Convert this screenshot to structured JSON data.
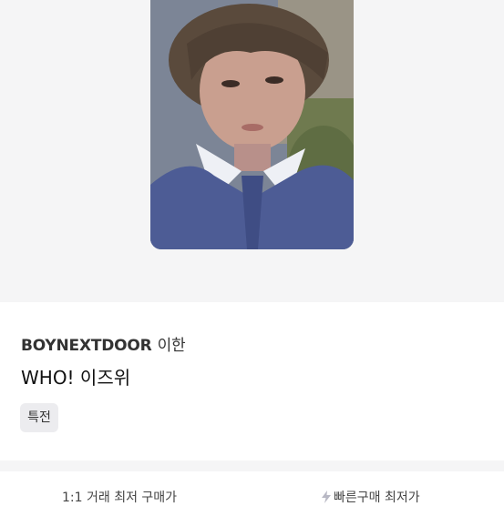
{
  "product": {
    "group": "BOYNEXTDOOR",
    "member": "이한",
    "title": "WHO! 이즈위",
    "tag": "특전"
  },
  "bottom_tabs": {
    "left_label": "1:1 거래 최저 구매가",
    "right_label": "빠른구매 최저가"
  },
  "icons": {
    "bolt": "lightning-bolt-icon"
  },
  "colors": {
    "hero_background": "#f5f5f6",
    "tag_background": "#ececef"
  }
}
